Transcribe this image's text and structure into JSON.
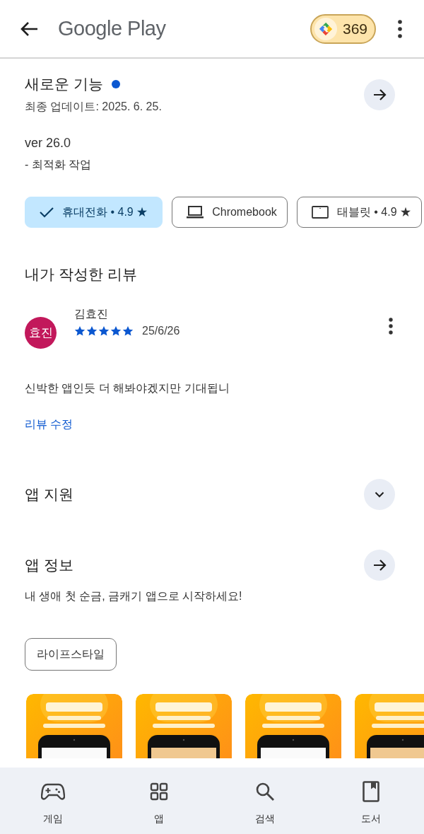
{
  "header": {
    "title": "Google Play",
    "points": "369"
  },
  "whats_new": {
    "title": "새로운 기능",
    "new": true,
    "updated": "최종 업데이트: 2025. 6. 25.",
    "notes": [
      "ver 26.0",
      "- 최적화 작업"
    ]
  },
  "devices": [
    {
      "label": "휴대전화 • 4.9 ★",
      "selected": true
    },
    {
      "label": "Chromebook",
      "kind": "laptop",
      "selected": false
    },
    {
      "label": "태블릿 • 4.9 ★",
      "kind": "tablet",
      "selected": false
    }
  ],
  "my_review": {
    "title": "내가 작성한 리뷰",
    "avatar": "효진",
    "name": "김효진",
    "stars": 5,
    "date": "25/6/26",
    "text": "신박한 앱인듯 더 해봐야겠지만 기대됩니",
    "edit": "리뷰 수정"
  },
  "app_support": {
    "title": "앱 지원",
    "expanded": false
  },
  "app_info": {
    "title": "앱 정보",
    "description": "내 생애 첫 순금, 금캐기 앱으로 시작하세요!",
    "tag": "라이프스타일"
  },
  "bottom_nav": [
    {
      "label": "게임",
      "kind": "games",
      "selected": false
    },
    {
      "label": "앱",
      "kind": "apps",
      "selected": false
    },
    {
      "label": "검색",
      "kind": "search",
      "selected": false
    },
    {
      "label": "도서",
      "kind": "books",
      "selected": false
    }
  ]
}
